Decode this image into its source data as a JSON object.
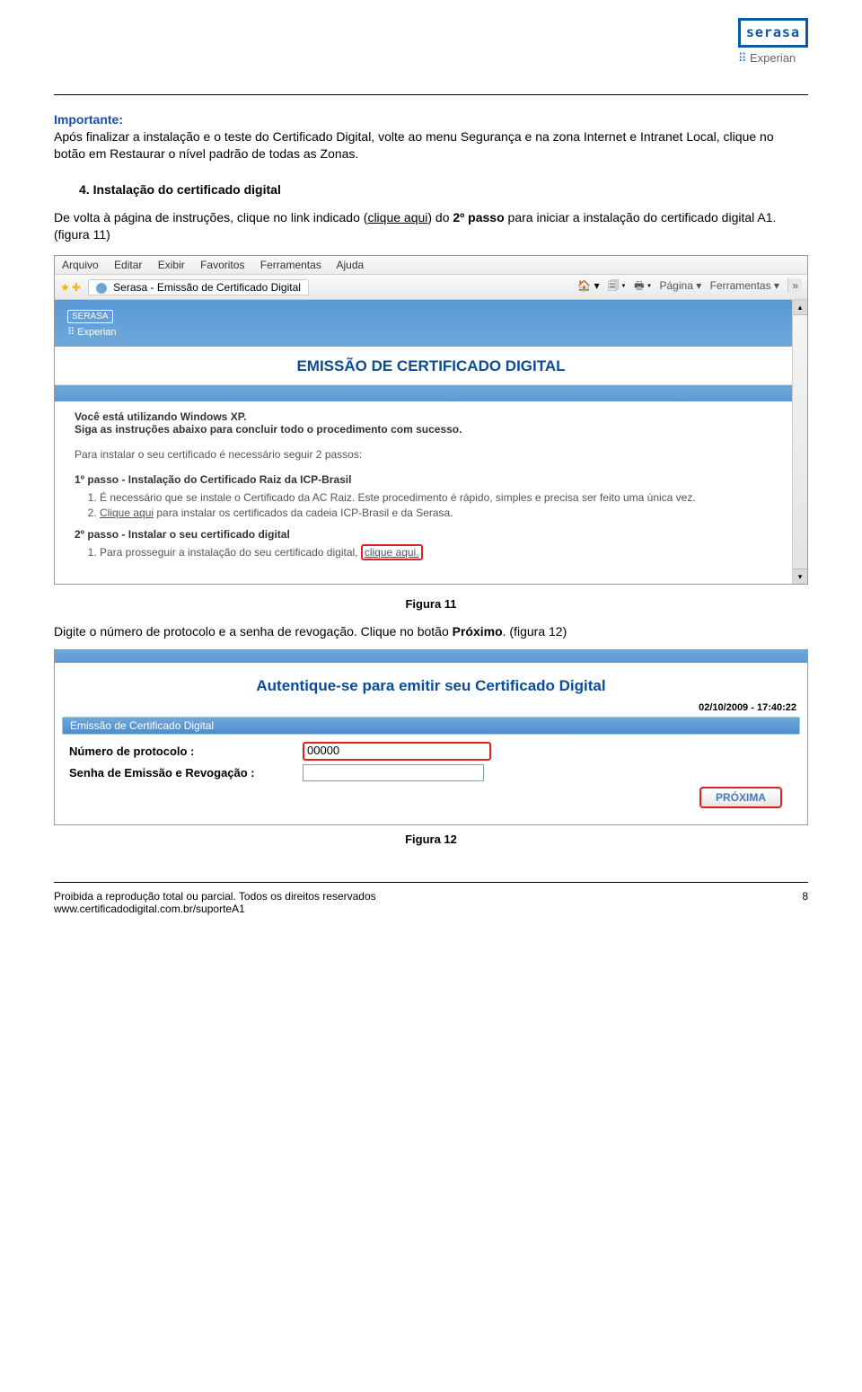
{
  "logo": {
    "name": "serasa",
    "sub_symbol": "⠿",
    "sub_text": "Experian"
  },
  "important": {
    "title": "Importante:",
    "text": "Após finalizar a instalação e o teste do Certificado Digital, volte ao menu Segurança e na zona Internet e Intranet Local, clique no botão em Restaurar o nível padrão de todas as Zonas."
  },
  "section4": {
    "num_label": "4.   Instalação do certificado digital",
    "para_pre": "De volta à página de instruções, clique no link indicado (",
    "link_text": "clique aqui",
    "para_mid": ") do ",
    "bold_step": "2º passo",
    "para_post": " para iniciar a instalação do certificado digital A1. (figura 11)"
  },
  "fig11": {
    "menus": [
      "Arquivo",
      "Editar",
      "Exibir",
      "Favoritos",
      "Ferramentas",
      "Ajuda"
    ],
    "tab_title": "Serasa - Emissão de Certificado Digital",
    "tools": {
      "home": "🏠",
      "feed": "🗐",
      "print": "🖶",
      "page": "Página ▾",
      "tools_label": "Ferramentas ▾"
    },
    "brand": "SERASA",
    "brand_sub": "⠿ Experian",
    "page_title": "EMISSÃO DE CERTIFICADO DIGITAL",
    "os_line1": "Você está utilizando Windows XP.",
    "os_line2": "Siga as instruções abaixo para concluir todo o procedimento com sucesso.",
    "intro": "Para instalar o seu certificado é necessário seguir 2 passos:",
    "step1_title": "1º passo - Instalação do Certificado Raiz da ICP-Brasil",
    "step1_items": [
      "É necessário que se instale o Certificado da AC Raiz. Este procedimento é rápido, simples e precisa ser feito uma única vez.",
      {
        "pre": "",
        "link": "Clique aqui",
        "post": " para instalar os certificados da cadeia ICP-Brasil e da Serasa."
      }
    ],
    "step2_title": "2º passo - Instalar o seu certificado digital",
    "step2_item_pre": "Para prosseguir a instalação do seu certificado digital, ",
    "step2_item_link": "clique aqui.",
    "caption": "Figura 11"
  },
  "between_text": {
    "pre": "Digite o número de protocolo e a senha de revogação. Clique no botão ",
    "bold": "Próximo",
    "post": ". (figura 12)"
  },
  "fig12": {
    "title": "Autentique-se para emitir seu Certificado Digital",
    "timestamp": "02/10/2009 - 17:40:22",
    "section_label": "Emissão de Certificado Digital",
    "field1_label": "Número de protocolo :",
    "field1_value": "00000",
    "field2_label": "Senha de Emissão e Revogação :",
    "button": "PRÓXIMA",
    "caption": "Figura 12"
  },
  "footer": {
    "left1": "Proibida a reprodução total ou parcial. Todos os direitos reservados",
    "left2": "www.certificadodigital.com.br/suporteA1",
    "page": "8"
  }
}
